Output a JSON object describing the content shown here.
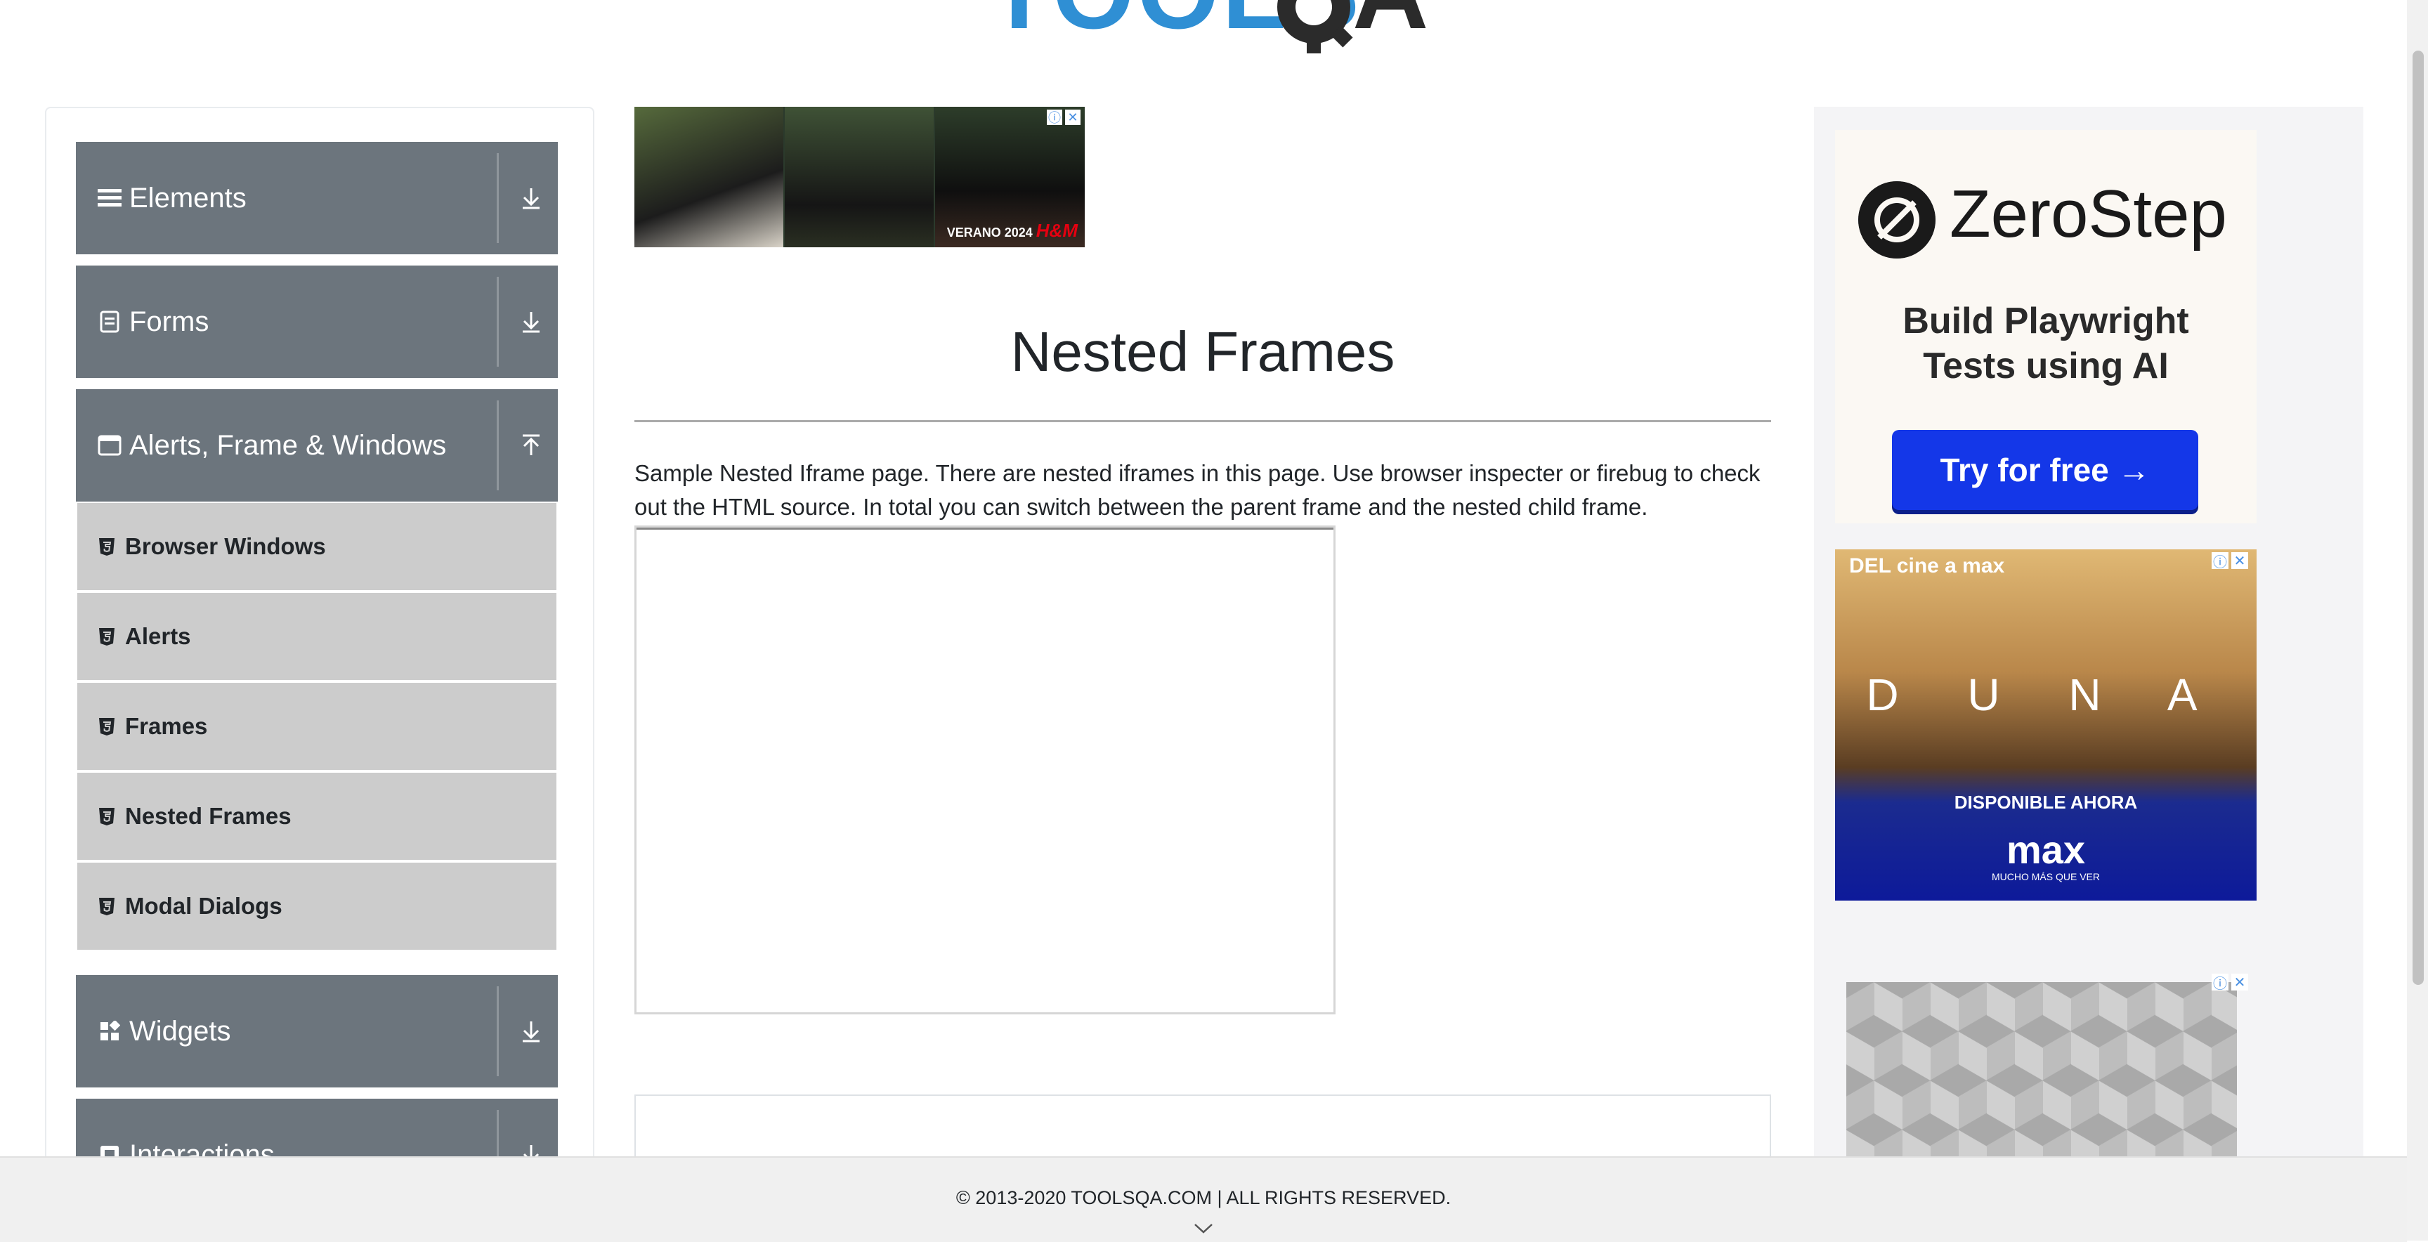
{
  "header": {
    "logo_alt": "TOOLSQA"
  },
  "sidebar": {
    "groups": [
      {
        "label": "Elements",
        "icon": "hamburger-icon",
        "state": "collapsed"
      },
      {
        "label": "Forms",
        "icon": "document-icon",
        "state": "collapsed"
      },
      {
        "label": "Alerts, Frame & Windows",
        "icon": "window-icon",
        "state": "expanded"
      },
      {
        "label": "Widgets",
        "icon": "widgets-icon",
        "state": "collapsed"
      },
      {
        "label": "Interactions",
        "icon": "interactions-icon",
        "state": "collapsed"
      }
    ],
    "sub_items": [
      {
        "label": "Browser Windows"
      },
      {
        "label": "Alerts"
      },
      {
        "label": "Frames"
      },
      {
        "label": "Nested Frames"
      },
      {
        "label": "Modal Dialogs"
      }
    ]
  },
  "main": {
    "title": "Nested Frames",
    "description": "Sample Nested Iframe page. There are nested iframes in this page. Use browser inspecter or firebug to check out the HTML source. In total you can switch between the parent frame and the nested child frame."
  },
  "ads": {
    "top_banner_caption": "VERANO 2024",
    "top_banner_brand": "H&M",
    "zerostep": {
      "brand": "ZeroStep",
      "tagline_1": "Build Playwright",
      "tagline_2": "Tests using AI",
      "button": "Try for free →"
    },
    "dune": {
      "corner": "DEL cine a max",
      "title": "D U N A",
      "available": "DISPONIBLE AHORA",
      "brand": "max",
      "slogan": "MUCHO MÁS QUE VER"
    }
  },
  "footer": {
    "text": "© 2013-2020 TOOLSQA.COM | ALL RIGHTS RESERVED."
  },
  "colors": {
    "group_bg": "#6c757d",
    "sub_bg": "#cccccc",
    "cta_blue": "#1437e8"
  }
}
